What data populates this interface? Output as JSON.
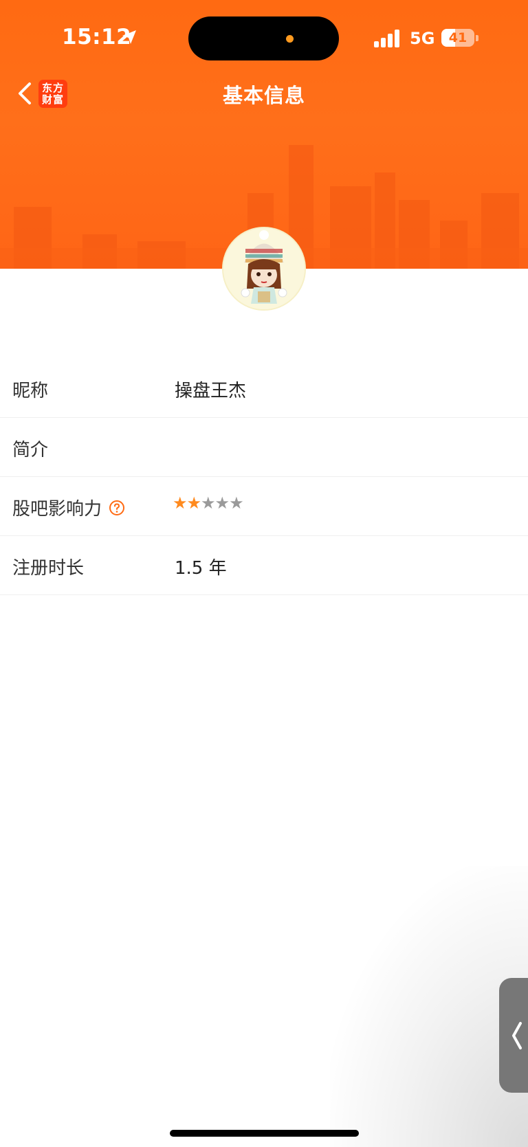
{
  "status_bar": {
    "time": "15:12",
    "network": "5G",
    "battery": "41",
    "battery_fraction": 0.41
  },
  "nav": {
    "title": "基本信息",
    "logo_line1": "东方",
    "logo_line2": "财富",
    "back_icon": "chevron-left-icon"
  },
  "profile": {
    "avatar": "avatar-cartoon-girl"
  },
  "info": {
    "rows": [
      {
        "label": "昵称",
        "value": "操盘王杰"
      },
      {
        "label": "简介",
        "value": ""
      },
      {
        "label": "股吧影响力",
        "rating": 2,
        "rating_max": 5
      },
      {
        "label": "注册时长",
        "value": "1.5 年"
      }
    ]
  },
  "colors": {
    "brand": "#ff6a12",
    "star_active": "#ff8a1e",
    "star_inactive": "#9a9a9a",
    "help": "#ff6a12"
  },
  "side_tab_icon": "chevron-left-icon"
}
